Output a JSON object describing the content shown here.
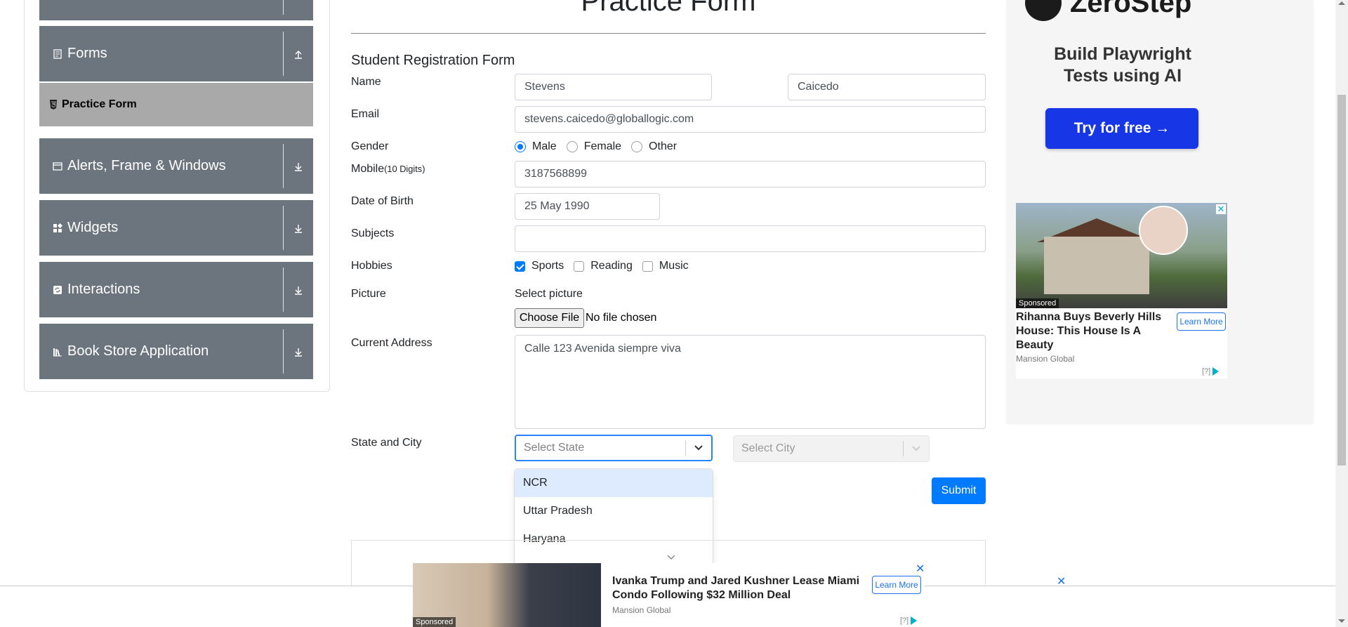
{
  "sidebar": {
    "groups": [
      {
        "label": "Forms",
        "icon": "document-icon",
        "arrow": "collapse-arrow-icon"
      },
      {
        "label": "Alerts, Frame & Windows",
        "icon": "window-icon",
        "arrow": "expand-arrow-icon"
      },
      {
        "label": "Widgets",
        "icon": "widgets-icon",
        "arrow": "expand-arrow-icon"
      },
      {
        "label": "Interactions",
        "icon": "interactions-icon",
        "arrow": "expand-arrow-icon"
      },
      {
        "label": "Book Store Application",
        "icon": "books-icon",
        "arrow": "expand-arrow-icon"
      }
    ],
    "active_item": {
      "label": "Practice Form",
      "icon": "html5-icon"
    }
  },
  "form": {
    "page_title": "Practice Form",
    "heading": "Student Registration Form",
    "labels": {
      "name": "Name",
      "email": "Email",
      "gender": "Gender",
      "mobile": "Mobile",
      "mobile_hint": "(10 Digits)",
      "dob": "Date of Birth",
      "subjects": "Subjects",
      "hobbies": "Hobbies",
      "picture": "Picture",
      "address": "Current Address",
      "state_city": "State and City"
    },
    "first_name": "Stevens",
    "last_name": "Caicedo",
    "email": "stevens.caicedo@globallogic.com",
    "gender_options": [
      "Male",
      "Female",
      "Other"
    ],
    "gender_selected": "Male",
    "mobile": "3187568899",
    "dob": "25 May 1990",
    "subjects": "",
    "hobby_options": [
      "Sports",
      "Reading",
      "Music"
    ],
    "hobbies_checked": [
      "Sports"
    ],
    "picture_caption": "Select picture",
    "file_button": "Choose File",
    "file_status": "No file chosen",
    "address": "Calle 123 Avenida siempre viva",
    "state_placeholder": "Select State",
    "city_placeholder": "Select City",
    "state_options": [
      "NCR",
      "Uttar Pradesh",
      "Haryana"
    ],
    "highlighted_state": "NCR",
    "submit": "Submit"
  },
  "ads": {
    "zerostep": {
      "brand": "ZeroStep",
      "headline_line1": "Build Playwright",
      "headline_line2": "Tests using AI",
      "cta": "Try for free →",
      "cta_color": "#1736e6"
    },
    "right_card": {
      "sponsored": "Sponsored",
      "headline": "Rihanna Buys Beverly Hills House: This House Is A Beauty",
      "source": "Mansion Global",
      "button": "Learn More",
      "adchoice": "[?]"
    },
    "bottom": {
      "sponsored": "Sponsored",
      "headline": "Ivanka Trump and Jared Kushner Lease Miami Condo Following $32 Million Deal",
      "source": "Mansion Global",
      "button": "Learn More",
      "adchoice": "[?]"
    }
  },
  "colors": {
    "sidebar_group": "#6c757d",
    "sidebar_active": "#a9a9a9",
    "primary": "#007bff",
    "dropdown_highlight": "#deebff"
  }
}
